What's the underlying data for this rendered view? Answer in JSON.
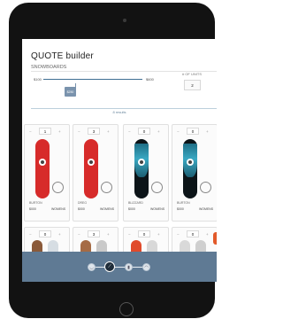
{
  "header": {
    "title": "QUOTE builder",
    "subtitle": "SNOWBOARDS"
  },
  "filters": {
    "price_min": "$100",
    "price_max": "$600",
    "handle": "$250",
    "units_label": "# OF UNITS",
    "units_value": "2"
  },
  "results": {
    "count": "8 results"
  },
  "cards": [
    {
      "qty": "1",
      "name": "BURTON",
      "price": "$000",
      "gender": "WOMENS",
      "board_color": "#d72b2a"
    },
    {
      "qty": "3",
      "name": "DREG",
      "price": "$000",
      "gender": "WOMENS",
      "board_color": "#d72b2a"
    },
    {
      "qty": "0",
      "name": "BLIZZARD",
      "price": "$000",
      "gender": "WOMENS",
      "board_color": "#0c1418"
    },
    {
      "qty": "0",
      "name": "BURTON",
      "price": "$000",
      "gender": "WOMENS",
      "board_color": "#0c1418"
    },
    {
      "qty": "0"
    },
    {
      "qty": "3"
    },
    {
      "qty": "0"
    },
    {
      "qty": "0"
    }
  ],
  "steps": {
    "icons": [
      "bucket-icon",
      "skier-icon",
      "boot-icon",
      "helmet-icon"
    ]
  },
  "colors": {
    "accent": "#3f6f93",
    "footer": "#5f7a94",
    "board_red": "#d72b2a"
  }
}
